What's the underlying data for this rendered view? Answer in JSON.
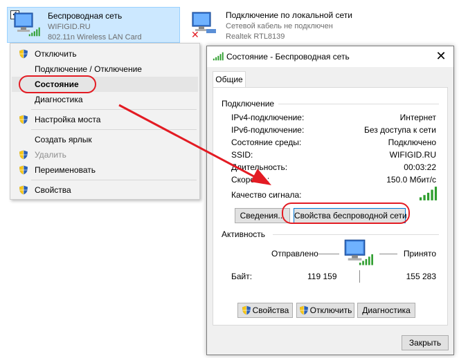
{
  "adapters": [
    {
      "name": "Беспроводная сеть",
      "line2": "WIFIGID.RU",
      "line3": "802.11n Wireless LAN Card",
      "checkbox": "✓"
    },
    {
      "name": "Подключение по локальной сети",
      "line2": "Сетевой кабель не подключен",
      "line3": "Realtek RTL8139"
    }
  ],
  "context_menu": {
    "items": [
      {
        "label": "Отключить",
        "shield": true,
        "disabled": false
      },
      {
        "label": "Подключение / Отключение",
        "shield": false,
        "disabled": false
      },
      {
        "label": "Состояние",
        "shield": false,
        "disabled": false,
        "highlighted": true
      },
      {
        "label": "Диагностика",
        "shield": false,
        "disabled": false
      },
      {
        "label": "Настройка моста",
        "shield": true,
        "disabled": false
      },
      {
        "label": "Создать ярлык",
        "shield": false,
        "disabled": false
      },
      {
        "label": "Удалить",
        "shield": true,
        "disabled": true
      },
      {
        "label": "Переименовать",
        "shield": true,
        "disabled": false
      },
      {
        "label": "Свойства",
        "shield": true,
        "disabled": false
      }
    ]
  },
  "dialog": {
    "title": "Состояние - Беспроводная сеть",
    "close_label": "✕",
    "tab_general": "Общие",
    "connection": {
      "heading": "Подключение",
      "rows": [
        {
          "key": "IPv4-подключение:",
          "value": "Интернет"
        },
        {
          "key": "IPv6-подключение:",
          "value": "Без доступа к сети"
        },
        {
          "key": "Состояние среды:",
          "value": "Подключено"
        },
        {
          "key": "SSID:",
          "value": "WIFIGID.RU"
        },
        {
          "key": "Длительность:",
          "value": "00:03:22"
        },
        {
          "key": "Скорость:",
          "value": "150.0 Мбит/с"
        }
      ],
      "signal_label": "Качество сигнала:",
      "signal_bars": 5
    },
    "buttons": {
      "details": "Сведения...",
      "wireless_properties": "Свойства беспроводной сети"
    },
    "activity": {
      "heading": "Активность",
      "sent_label": "Отправлено",
      "received_label": "Принято",
      "bytes_label": "Байт:",
      "sent_value": "119 159",
      "received_value": "155 283"
    },
    "bottom_buttons": {
      "properties": "Свойства",
      "disable": "Отключить",
      "diagnostics": "Диагностика"
    },
    "close_button": "Закрыть"
  },
  "colors": {
    "selection_bg": "#cce8ff",
    "annotation_red": "#e31b23",
    "signal_green": "#2e9e2e",
    "focus_blue": "#0078d7"
  }
}
